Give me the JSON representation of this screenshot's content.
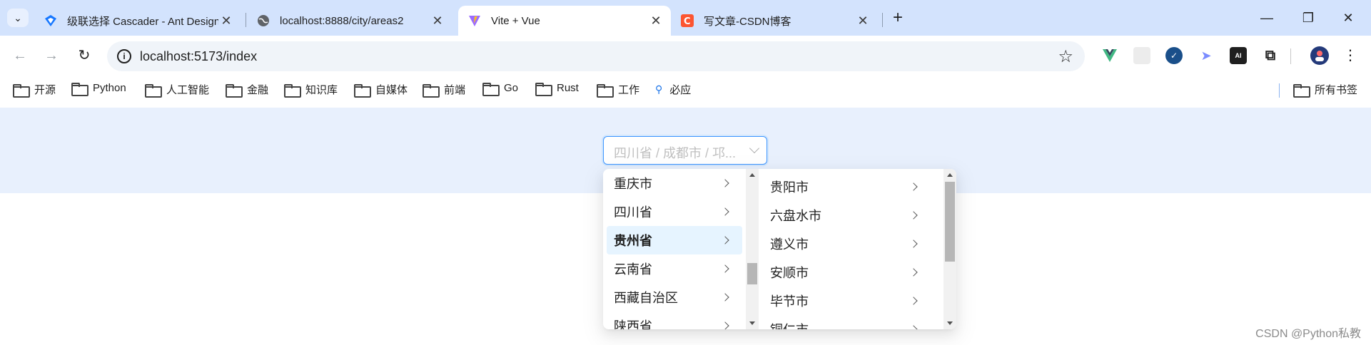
{
  "browser": {
    "tabs": [
      {
        "title": "级联选择 Cascader - Ant Design",
        "active": false,
        "favicon": "ant-design-icon"
      },
      {
        "title": "localhost:8888/city/areas2",
        "active": false,
        "favicon": "globe-icon"
      },
      {
        "title": "Vite + Vue",
        "active": true,
        "favicon": "vite-icon"
      },
      {
        "title": "写文章-CSDN博客",
        "active": false,
        "favicon": "csdn-icon"
      }
    ],
    "close_glyph": "✕",
    "new_tab_glyph": "+",
    "window_controls": {
      "minimize": "—",
      "restore": "❐",
      "close": "✕"
    },
    "url": "localhost:5173/index",
    "nav": {
      "back": "←",
      "forward": "→",
      "reload": "↻"
    },
    "star_glyph": "☆",
    "extensions": [
      {
        "name": "vue-devtools-icon",
        "color": "#41b883",
        "glyph": "▼"
      },
      {
        "name": "blank-extension-icon",
        "color": "#e5e5e5",
        "glyph": ""
      },
      {
        "name": "check-circle-icon",
        "color": "#1a4f8a",
        "glyph": "✓"
      },
      {
        "name": "bird-icon",
        "color": "#8c9bff",
        "glyph": "➤"
      },
      {
        "name": "aitdk-icon",
        "color": "#1f1f1f",
        "glyph": "AI"
      },
      {
        "name": "puzzle-extensions-icon",
        "color": "#ffffff",
        "glyph": "⧉"
      }
    ],
    "menu_glyph": "⋮",
    "bookmarks": [
      {
        "label": "开源",
        "type": "folder"
      },
      {
        "label": "Python",
        "type": "folder"
      },
      {
        "label": "人工智能",
        "type": "folder"
      },
      {
        "label": "金融",
        "type": "folder"
      },
      {
        "label": "知识库",
        "type": "folder"
      },
      {
        "label": "自媒体",
        "type": "folder"
      },
      {
        "label": "前端",
        "type": "folder"
      },
      {
        "label": "Go",
        "type": "folder"
      },
      {
        "label": "Rust",
        "type": "folder"
      },
      {
        "label": "工作",
        "type": "folder"
      },
      {
        "label": "必应",
        "type": "search"
      }
    ],
    "all_bookmarks": "所有书签"
  },
  "page": {
    "cascader": {
      "placeholder": "四川省 / 成都市 / 邛..."
    },
    "menu1": {
      "items": [
        {
          "label": "重庆市",
          "active": false
        },
        {
          "label": "四川省",
          "active": false
        },
        {
          "label": "贵州省",
          "active": true
        },
        {
          "label": "云南省",
          "active": false
        },
        {
          "label": "西藏自治区",
          "active": false
        },
        {
          "label": "陕西省",
          "active": false
        }
      ]
    },
    "menu2": {
      "items": [
        {
          "label": "贵阳市",
          "active": false
        },
        {
          "label": "六盘水市",
          "active": false
        },
        {
          "label": "遵义市",
          "active": false
        },
        {
          "label": "安顺市",
          "active": false
        },
        {
          "label": "毕节市",
          "active": false
        },
        {
          "label": "铜仁市",
          "active": false
        }
      ]
    },
    "watermark": "CSDN @Python私教"
  },
  "colors": {
    "tabstrip": "#d3e3fd",
    "page_band": "#e8f0fd",
    "accent": "#4096ff",
    "active_item_bg": "#e6f4ff"
  }
}
